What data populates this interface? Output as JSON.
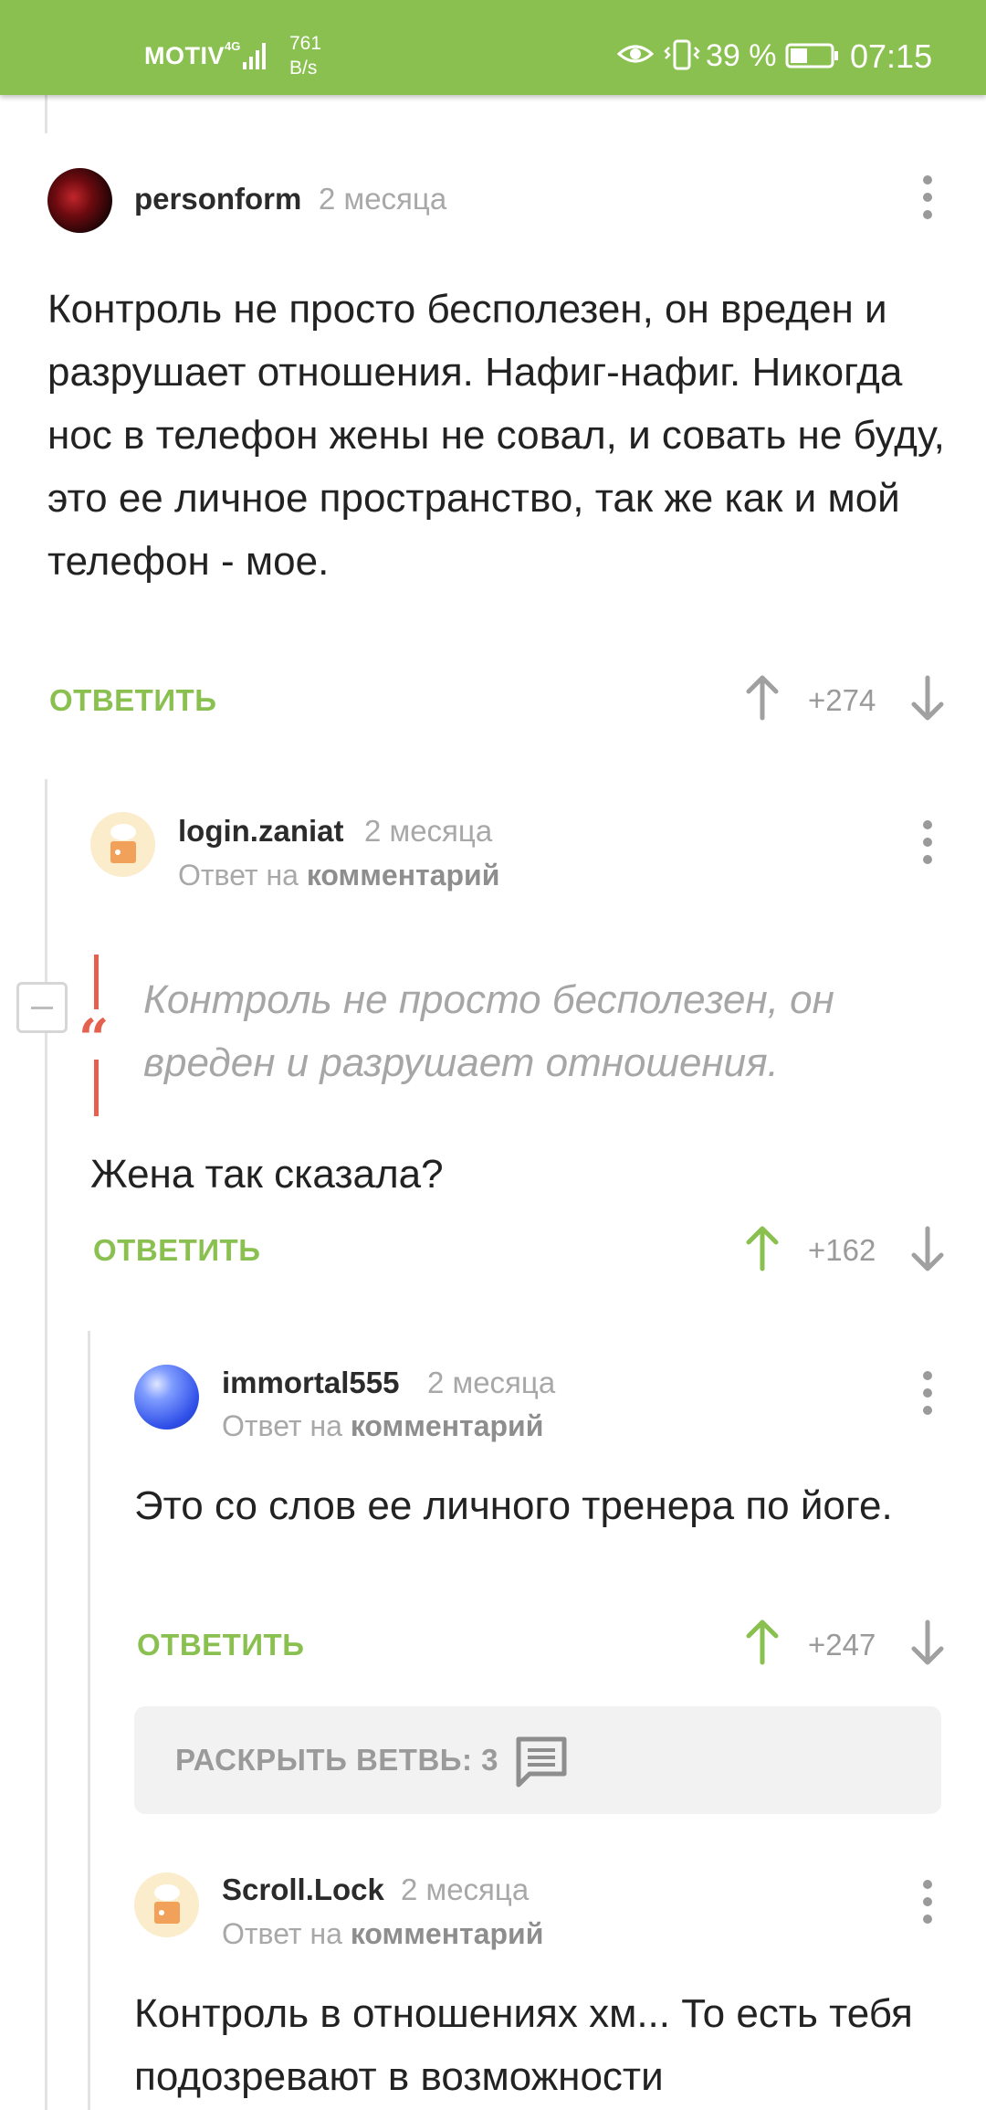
{
  "status_bar": {
    "carrier": "MOTIV",
    "network": "4G",
    "speed_value": "761",
    "speed_unit": "B/s",
    "battery": "39 %",
    "time": "07:15",
    "bg_color": "#8ac04f"
  },
  "comments": [
    {
      "username": "personform",
      "time": "2 месяца",
      "text": "Контроль не просто бесполезен, он вреден и разрушает отношения. Нафиг-нафиг. Никогда нос в телефон жены не совал, и совать не буду, это ее личное пространство, так же как и мой телефон - мое.",
      "reply_label": "ОТВЕТИТЬ",
      "rating": "+274",
      "upvoted": false
    },
    {
      "username": "login.zaniat",
      "time": "2 месяца",
      "reply_to_prefix": "Ответ на",
      "reply_to_target": "комментарий",
      "quote": "Контроль не просто бесполезен, он вреден и разрушает отношения.",
      "text": "Жена так сказала?",
      "reply_label": "ОТВЕТИТЬ",
      "rating": "+162",
      "upvoted": true
    },
    {
      "username": "immortal555",
      "time": "2 месяца",
      "reply_to_prefix": "Ответ на",
      "reply_to_target": "комментарий",
      "text": "Это со слов ее личного тренера по йоге.",
      "reply_label": "ОТВЕТИТЬ",
      "rating": "+247",
      "upvoted": true
    },
    {
      "username": "Scroll.Lock",
      "time": "2 месяца",
      "reply_to_prefix": "Ответ на",
      "reply_to_target": "комментарий",
      "text": "Контроль в отношениях хм... То есть тебя подозревают в возможности"
    }
  ],
  "expand_thread": {
    "label": "РАСКРЫТЬ ВЕТВЬ: 3"
  },
  "colors": {
    "accent": "#8ac04f",
    "quote": "#e4604f",
    "muted": "#a8a8a8"
  }
}
